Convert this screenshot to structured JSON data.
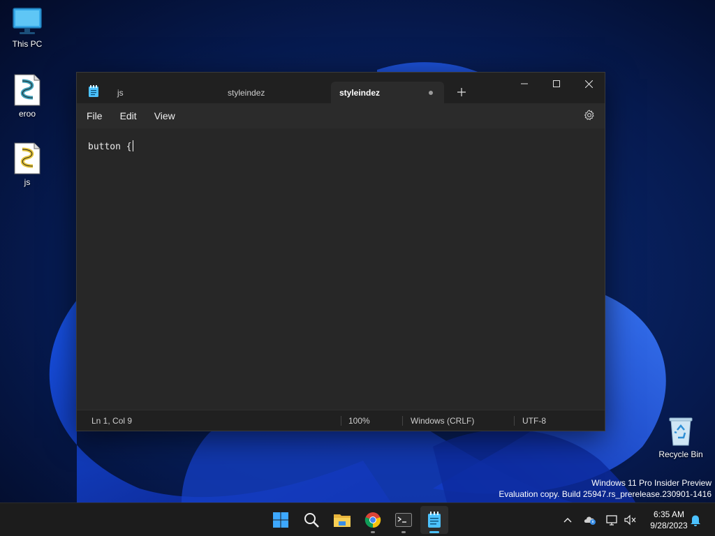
{
  "desktop": {
    "icons": [
      {
        "label": "This PC",
        "icon": "monitor-icon"
      },
      {
        "label": "eroo",
        "icon": "script-file-icon"
      },
      {
        "label": "js",
        "icon": "script-file-icon"
      },
      {
        "label": "Recycle Bin",
        "icon": "recycle-bin-icon"
      }
    ]
  },
  "notepad": {
    "tabs": [
      {
        "label": "js",
        "active": false
      },
      {
        "label": "styleindez",
        "active": false
      },
      {
        "label": "styleindez",
        "active": true,
        "unsaved": true
      }
    ],
    "menu": [
      "File",
      "Edit",
      "View"
    ],
    "content": "button {",
    "status": {
      "position": "Ln 1, Col 9",
      "zoom": "100%",
      "line_ending": "Windows (CRLF)",
      "encoding": "UTF-8"
    }
  },
  "watermark": {
    "line1": "Windows 11 Pro Insider Preview",
    "line2": "Evaluation copy. Build 25947.rs_prerelease.230901-1416"
  },
  "taskbar": {
    "apps": [
      "start-icon",
      "search-icon",
      "file-explorer-icon",
      "chrome-icon",
      "terminal-icon",
      "notepad-icon"
    ],
    "clock": {
      "time": "6:35 AM",
      "date": "9/28/2023"
    }
  },
  "colors": {
    "accent": "#4cc2ff",
    "window_bg": "#272727",
    "taskbar_bg": "#1c1c1c"
  }
}
